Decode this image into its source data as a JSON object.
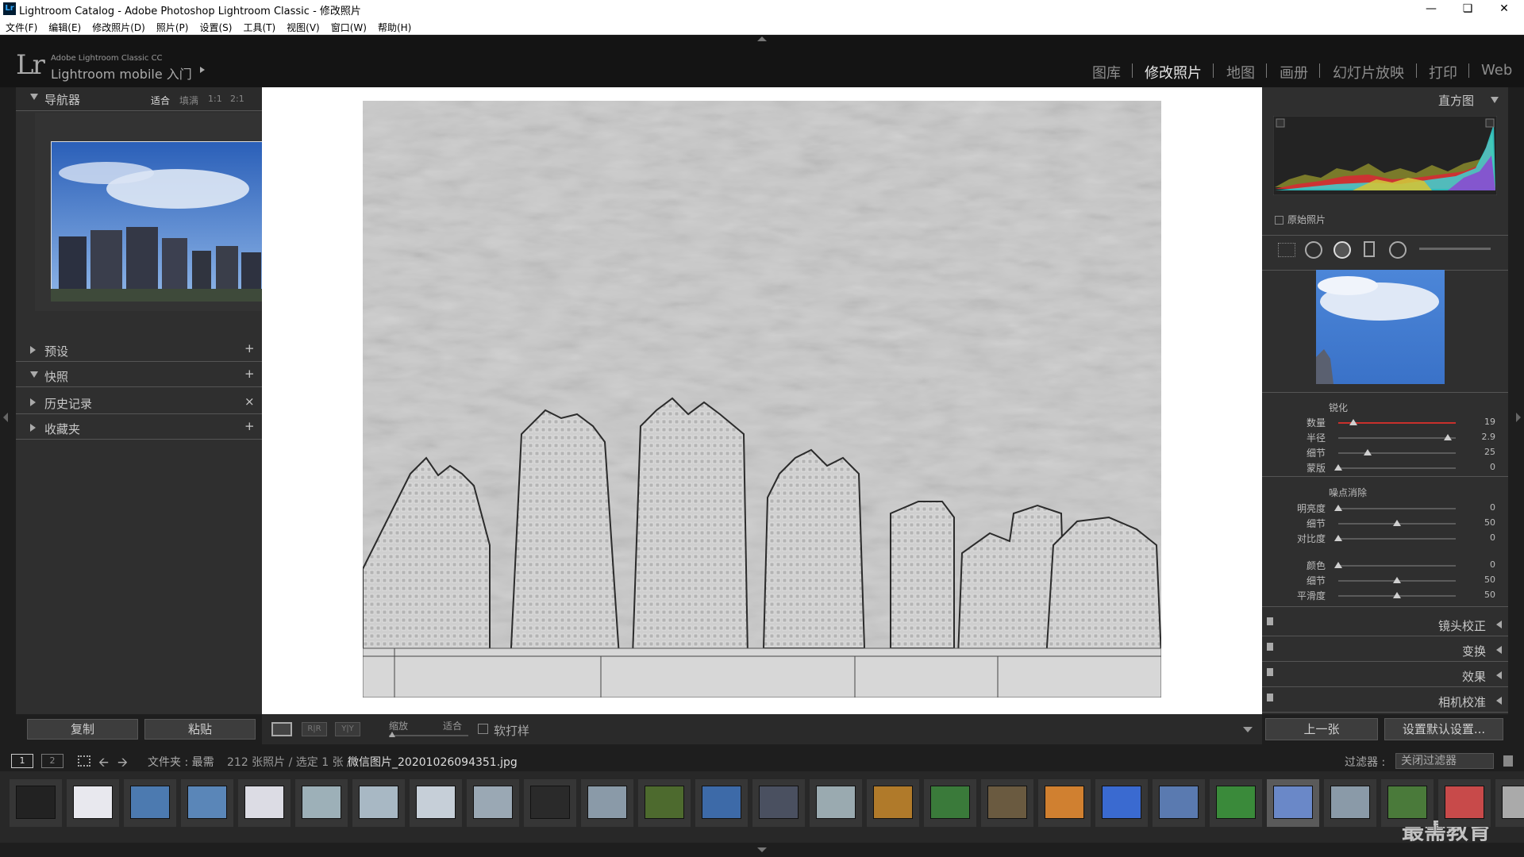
{
  "window": {
    "title": "Lightroom Catalog - Adobe Photoshop Lightroom Classic - 修改照片",
    "icon": "Lr"
  },
  "menu": [
    "文件(F)",
    "编辑(E)",
    "修改照片(D)",
    "照片(P)",
    "设置(S)",
    "工具(T)",
    "视图(V)",
    "窗口(W)",
    "帮助(H)"
  ],
  "identity": {
    "logo": "Lr",
    "product": "Adobe Lightroom Classic CC",
    "mobile": "Lightroom mobile 入门"
  },
  "modules": [
    "图库",
    "修改照片",
    "地图",
    "画册",
    "幻灯片放映",
    "打印",
    "Web"
  ],
  "left_panel": {
    "navigator": {
      "title": "导航器",
      "zoom_options": [
        "适合",
        "填满",
        "1:1",
        "2:1"
      ]
    },
    "sections": [
      {
        "label": "预设",
        "action": "+"
      },
      {
        "label": "快照",
        "action": "+"
      },
      {
        "label": "历史记录",
        "action": "×"
      },
      {
        "label": "收藏夹",
        "action": "+"
      }
    ],
    "copy_label": "复制",
    "paste_label": "粘贴"
  },
  "right_panel": {
    "histogram_title": "直方图",
    "original_photo": "原始照片",
    "sharpening": {
      "title": "锐化",
      "sliders": [
        {
          "label": "数量",
          "value": "19",
          "level": 0.13
        },
        {
          "label": "半径",
          "value": "2.9",
          "level": 0.93
        },
        {
          "label": "细节",
          "value": "25",
          "level": 0.25
        },
        {
          "label": "蒙版",
          "value": "0",
          "level": 0.0
        }
      ]
    },
    "noise": {
      "title": "噪点消除",
      "luminance": [
        {
          "label": "明亮度",
          "value": "0",
          "level": 0.0
        },
        {
          "label": "细节",
          "value": "50",
          "level": 0.5
        },
        {
          "label": "对比度",
          "value": "0",
          "level": 0.0
        }
      ],
      "color": [
        {
          "label": "颜色",
          "value": "0",
          "level": 0.0
        },
        {
          "label": "细节",
          "value": "50",
          "level": 0.5
        },
        {
          "label": "平滑度",
          "value": "50",
          "level": 0.5
        }
      ]
    },
    "collapsed": [
      "镜头校正",
      "变换",
      "效果",
      "相机校准"
    ],
    "prev_label": "上一张",
    "reset_label": "设置默认设置..."
  },
  "toolbar": {
    "zoom_label": "缩放",
    "fit_label": "适合",
    "softproof_label": "软打样"
  },
  "filmbar": {
    "page1": "1",
    "page2": "2",
    "folder_prefix": "文件夹 : 最需",
    "count": "212 张照片 / 选定 1 张 /",
    "filename": "微信图片_20201026094351.jpg",
    "filter_label": "过滤器 :",
    "filter_value": "关闭过滤器"
  },
  "watermark": "最需教育",
  "colors": {
    "accent_red": "#c8302c",
    "panel": "#2f2f2f",
    "background": "#1e1e1e"
  }
}
